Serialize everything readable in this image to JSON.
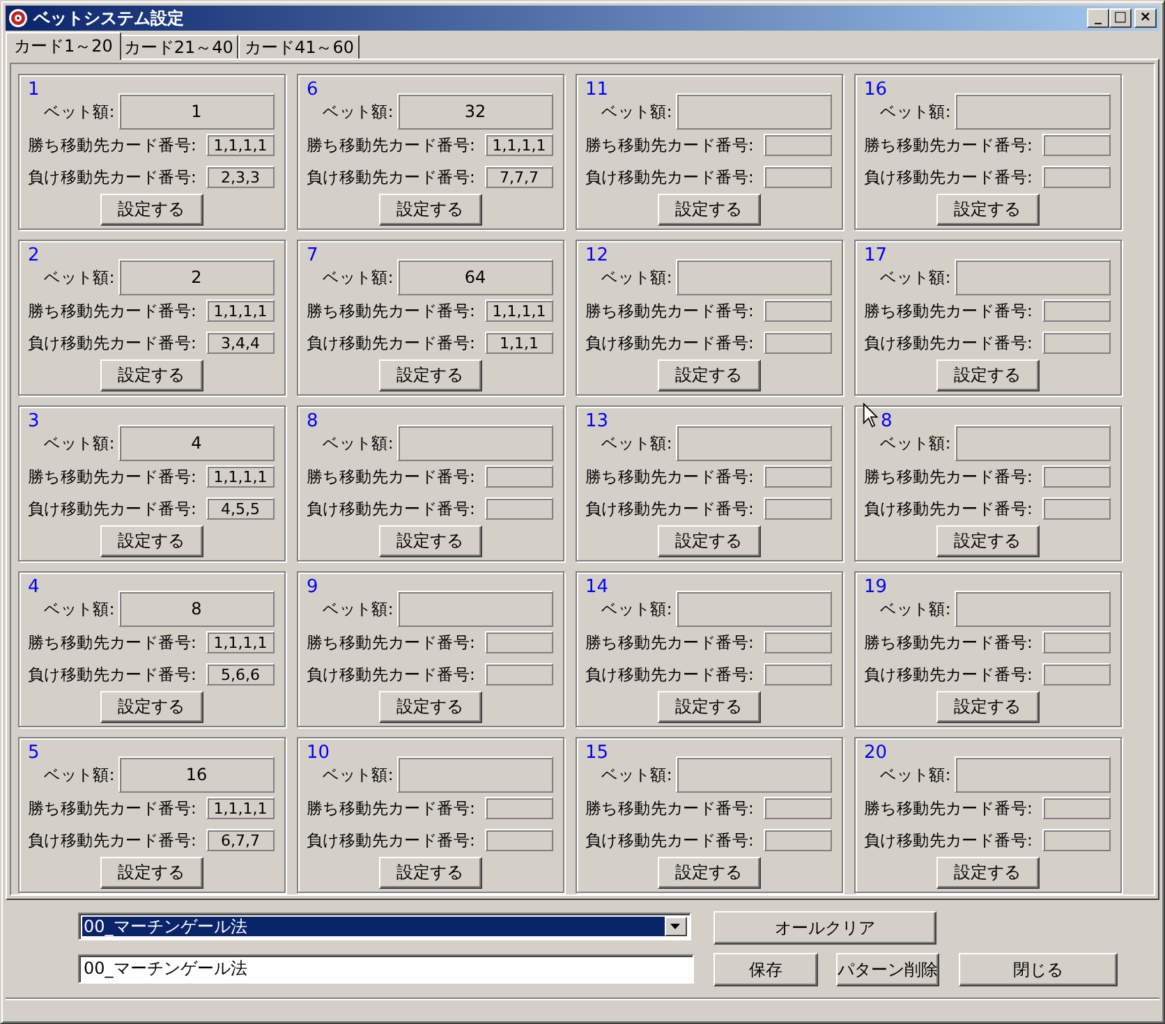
{
  "window": {
    "title": "ベットシステム設定",
    "buttons": [
      "_",
      "□",
      "×"
    ]
  },
  "tabs": [
    {
      "label": "カード1～20",
      "selected": true
    },
    {
      "label": "カード21～40",
      "selected": false
    },
    {
      "label": "カード41～60",
      "selected": false
    }
  ],
  "cards": [
    {
      "number": "1",
      "bet_label": "ベット額:",
      "bet": "1",
      "win_label": "勝ち移動先カード番号:",
      "win": "1,1,1,1",
      "lose_label": "負け移動先カード番号:",
      "lose": "2,3,3",
      "button": "設定する"
    },
    {
      "number": "2",
      "bet_label": "ベット額:",
      "bet": "2",
      "win_label": "勝ち移動先カード番号:",
      "win": "1,1,1,1",
      "lose_label": "負け移動先カード番号:",
      "lose": "3,4,4",
      "button": "設定する"
    },
    {
      "number": "3",
      "bet_label": "ベット額:",
      "bet": "4",
      "win_label": "勝ち移動先カード番号:",
      "win": "1,1,1,1",
      "lose_label": "負け移動先カード番号:",
      "lose": "4,5,5",
      "button": "設定する"
    },
    {
      "number": "4",
      "bet_label": "ベット額:",
      "bet": "8",
      "win_label": "勝ち移動先カード番号:",
      "win": "1,1,1,1",
      "lose_label": "負け移動先カード番号:",
      "lose": "5,6,6",
      "button": "設定する"
    },
    {
      "number": "5",
      "bet_label": "ベット額:",
      "bet": "16",
      "win_label": "勝ち移動先カード番号:",
      "win": "1,1,1,1",
      "lose_label": "負け移動先カード番号:",
      "lose": "6,7,7",
      "button": "設定する"
    },
    {
      "number": "6",
      "bet_label": "ベット額:",
      "bet": "32",
      "win_label": "勝ち移動先カード番号:",
      "win": "1,1,1,1",
      "lose_label": "負け移動先カード番号:",
      "lose": "7,7,7",
      "button": "設定する"
    },
    {
      "number": "7",
      "bet_label": "ベット額:",
      "bet": "64",
      "win_label": "勝ち移動先カード番号:",
      "win": "1,1,1,1",
      "lose_label": "負け移動先カード番号:",
      "lose": "1,1,1",
      "button": "設定する"
    },
    {
      "number": "8",
      "bet_label": "ベット額:",
      "win_label": "勝ち移動先カード番号:",
      "lose_label": "負け移動先カード番号:",
      "button": "設定する"
    },
    {
      "number": "9",
      "bet_label": "ベット額:",
      "win_label": "勝ち移動先カード番号:",
      "lose_label": "負け移動先カード番号:",
      "button": "設定する"
    },
    {
      "number": "10",
      "bet_label": "ベット額:",
      "win_label": "勝ち移動先カード番号:",
      "lose_label": "負け移動先カード番号:",
      "button": "設定する"
    },
    {
      "number": "11",
      "bet_label": "ベット額:",
      "win_label": "勝ち移動先カード番号:",
      "lose_label": "負け移動先カード番号:",
      "button": "設定する"
    },
    {
      "number": "12",
      "bet_label": "ベット額:",
      "win_label": "勝ち移動先カード番号:",
      "lose_label": "負け移動先カード番号:",
      "button": "設定する"
    },
    {
      "number": "13",
      "bet_label": "ベット額:",
      "win_label": "勝ち移動先カード番号:",
      "lose_label": "負け移動先カード番号:",
      "button": "設定する"
    },
    {
      "number": "14",
      "bet_label": "ベット額:",
      "win_label": "勝ち移動先カード番号:",
      "lose_label": "負け移動先カード番号:",
      "button": "設定する"
    },
    {
      "number": "15",
      "bet_label": "ベット額:",
      "win_label": "勝ち移動先カード番号:",
      "lose_label": "負け移動先カード番号:",
      "button": "設定する"
    },
    {
      "number": "16",
      "bet_label": "ベット額:",
      "win_label": "勝ち移動先カード番号:",
      "lose_label": "負け移動先カード番号:",
      "button": "設定する"
    },
    {
      "number": "17",
      "bet_label": "ベット額:",
      "win_label": "勝ち移動先カード番号:",
      "lose_label": "負け移動先カード番号:",
      "button": "設定する"
    },
    {
      "number": "8",
      "cursor": true,
      "bet_label": "ベット額:",
      "win_label": "勝ち移動先カード番号:",
      "lose_label": "負け移動先カード番号:",
      "button": "設定する"
    },
    {
      "number": "19",
      "bet_label": "ベット額:",
      "win_label": "勝ち移動先カード番号:",
      "lose_label": "負け移動先カード番号:",
      "button": "設定する"
    },
    {
      "number": "20",
      "bet_label": "ベット額:",
      "win_label": "勝ち移動先カード番号:",
      "lose_label": "負け移動先カード番号:",
      "button": "設定する"
    }
  ],
  "pattern_dropdown": {
    "value": "00_マーチンゲール法"
  },
  "pattern_name": {
    "value": "00_マーチンゲール法"
  },
  "buttons": {
    "clear_all": "オールクリア",
    "save": "保存",
    "delete_pattern": "パターン削除",
    "close": "閉じる"
  }
}
